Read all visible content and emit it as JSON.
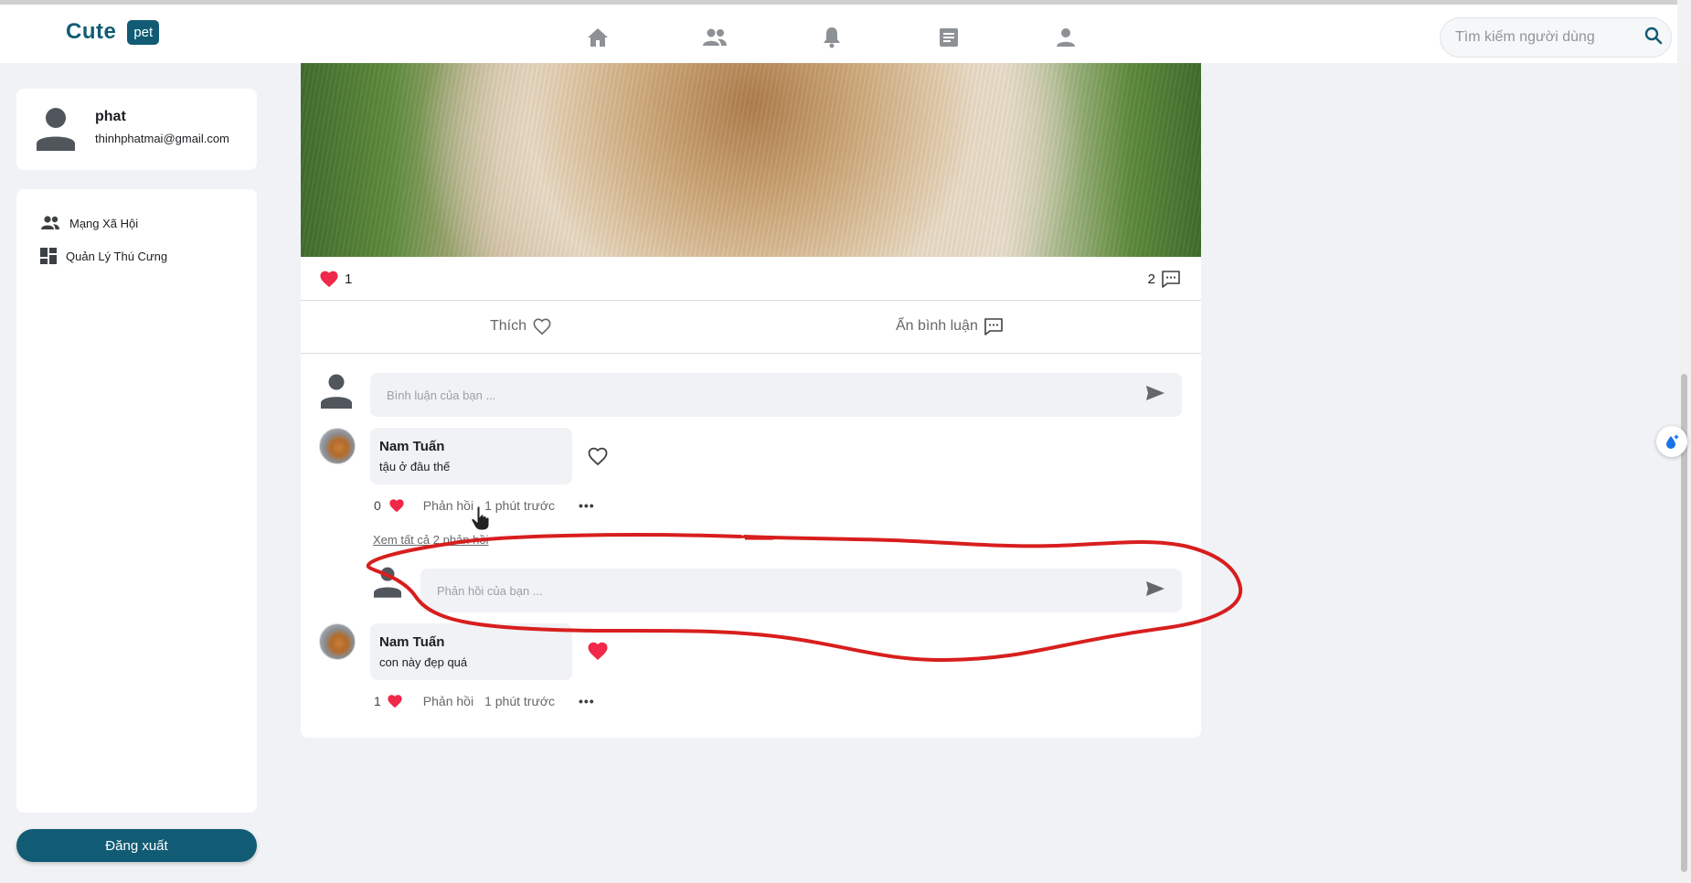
{
  "header": {
    "brand_name": "Cute",
    "brand_tag": "pet",
    "nav_icons": [
      "home-icon",
      "friends-icon",
      "bell-icon",
      "document-icon",
      "user-icon"
    ],
    "search_placeholder": "Tìm kiếm người dùng"
  },
  "profile": {
    "name": "phat",
    "email": "thinhphatmai@gmail.com"
  },
  "sidebar": {
    "items": [
      {
        "label": "Mạng Xã Hội",
        "icon": "people-icon"
      },
      {
        "label": "Quản Lý Thú Cưng",
        "icon": "dashboard-icon"
      }
    ],
    "logout_label": "Đăng xuất"
  },
  "post": {
    "like_count": "1",
    "comment_count": "2",
    "like_label": "Thích",
    "toggle_comments_label": "Ẩn bình luận",
    "comment_placeholder": "Bình luận của bạn ...",
    "comments": [
      {
        "author": "Nam Tuấn",
        "text": "tậu ở đâu thế",
        "likes": "0",
        "reply_label": "Phản hồi",
        "time": "1 phút trước",
        "view_replies": "Xem tất cả 2 phản hồi",
        "reply_placeholder": "Phản hồi của bạn ..."
      },
      {
        "author": "Nam Tuấn",
        "text": "con này đẹp quá",
        "likes": "1",
        "reply_label": "Phản hồi",
        "time": "1 phút trước"
      }
    ]
  },
  "colors": {
    "brand": "#115c74",
    "like_red": "#f02849",
    "annotation_red": "#d81e1e"
  }
}
